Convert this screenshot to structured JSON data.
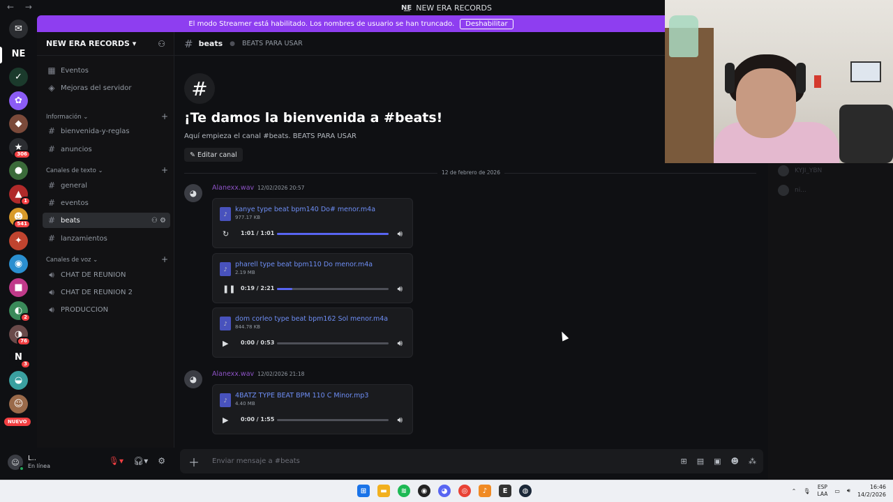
{
  "window": {
    "title": "NEW ERA RECORDS",
    "nav_arrows": "← →"
  },
  "banner": {
    "text": "El modo Streamer está habilitado. Los nombres de usuario se han truncado.",
    "button": "Deshabilitar"
  },
  "rail": {
    "servers": [
      {
        "label": "NE",
        "color": "#0f1013",
        "badge": ""
      },
      {
        "label": "✓",
        "color": "#1b3a2c",
        "badge": ""
      },
      {
        "label": "✿",
        "color": "#8b5cf6",
        "badge": ""
      },
      {
        "label": "◆",
        "color": "#7b4a3a",
        "badge": ""
      },
      {
        "label": "★",
        "color": "#2b2d31",
        "badge": "306"
      },
      {
        "label": "●",
        "color": "#3b6b3a",
        "badge": ""
      },
      {
        "label": "▲",
        "color": "#b02a2a",
        "badge": "1"
      },
      {
        "label": "☻",
        "color": "#d89a2a",
        "badge": "541"
      },
      {
        "label": "✦",
        "color": "#c0442f",
        "badge": ""
      },
      {
        "label": "◉",
        "color": "#2a8fd0",
        "badge": ""
      },
      {
        "label": "■",
        "color": "#c03a8a",
        "badge": ""
      },
      {
        "label": "◐",
        "color": "#3a8a5a",
        "badge": "2"
      },
      {
        "label": "◑",
        "color": "#6a4a4a",
        "badge": "76"
      },
      {
        "label": "N",
        "color": "#0f1013",
        "badge": "3"
      },
      {
        "label": "◒",
        "color": "#3aa0a0",
        "badge": ""
      },
      {
        "label": "☺",
        "color": "#9a6a4a",
        "badge": ""
      }
    ],
    "new_label": "NUEVO"
  },
  "sidebar": {
    "guild_name": "NEW ERA RECORDS",
    "top_items": [
      {
        "icon": "▦",
        "label": "Eventos"
      },
      {
        "icon": "◈",
        "label": "Mejoras del servidor"
      }
    ],
    "categories": [
      {
        "name": "Información",
        "channels": [
          "bienvenida-y-reglas",
          "anuncios"
        ]
      },
      {
        "name": "Canales de texto",
        "channels": [
          "general",
          "eventos",
          "beats",
          "lanzamientos"
        ]
      },
      {
        "name": "Canales de voz",
        "channels": [
          "CHAT DE REUNION",
          "CHAT DE REUNION 2",
          "PRODUCCION"
        ]
      }
    ]
  },
  "user": {
    "name": "L..",
    "status": "En línea"
  },
  "channel": {
    "name": "beats",
    "topic": "BEATS PARA USAR"
  },
  "welcome": {
    "title": "¡Te damos la bienvenida a #beats!",
    "subtitle": "Aquí empieza el canal #beats. BEATS PARA USAR",
    "edit_button": "Editar canal",
    "date_divider": "12 de febrero de 2026"
  },
  "messages": [
    {
      "author": "Alanexx.wav",
      "time": "12/02/2026 20:57",
      "attachments": [
        {
          "name": "kanye type beat bpm140 Do# menor.m4a",
          "size": "977.17 KB",
          "time": "1:01 / 1:01",
          "state": "replay",
          "progress": 1.0
        },
        {
          "name": "pharell type beat bpm110 Do menor.m4a",
          "size": "2.19 MB",
          "time": "0:19 / 2:21",
          "state": "pause",
          "progress": 0.14
        },
        {
          "name": "dom corleo type beat bpm162 Sol menor.m4a",
          "size": "844.78 KB",
          "time": "0:00 / 0:53",
          "state": "play",
          "progress": 0.0
        }
      ]
    },
    {
      "author": "Alanexx.wav",
      "time": "12/02/2026 21:18",
      "attachments": [
        {
          "name": "4BATZ TYPE BEAT BPM 110 C Minor.mp3",
          "size": "4.40 MB",
          "time": "0:00 / 1:55",
          "state": "play",
          "progress": 0.0
        }
      ]
    }
  ],
  "composer": {
    "placeholder": "Enviar mensaje a #beats"
  },
  "members": [
    {
      "name": "KYJI_YBN"
    },
    {
      "name": "ni..."
    }
  ],
  "taskbar": {
    "lang": "ESP",
    "lang2": "LAA",
    "time": "16:46",
    "date": "14/2/2026"
  }
}
